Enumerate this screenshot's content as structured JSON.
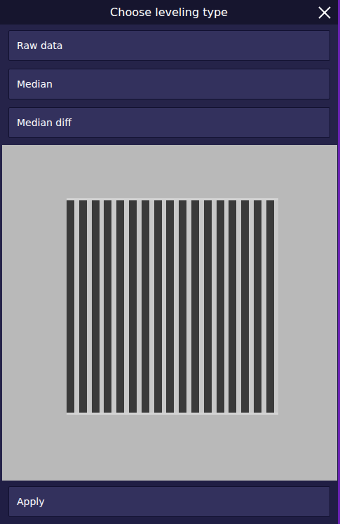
{
  "window": {
    "title": "Choose leveling type"
  },
  "options": [
    {
      "label": "Raw data"
    },
    {
      "label": "Median"
    },
    {
      "label": "Median diff"
    }
  ],
  "buttons": [
    "Apply"
  ]
}
